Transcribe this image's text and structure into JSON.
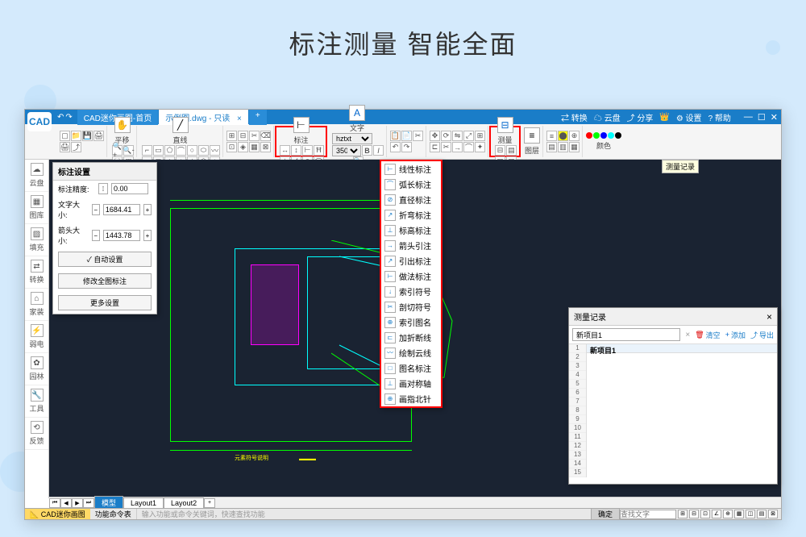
{
  "hero_title": "标注测量 智能全面",
  "titlebar": {
    "logo": "CAD",
    "tab_home": "CAD迷你画图-首页",
    "tab_file": "示例图.dwg - 只读",
    "menu_convert": "⇄ 转换",
    "menu_cloud": "☁ 云盘",
    "menu_share": "⤴ 分享",
    "menu_settings": "⚙ 设置",
    "menu_help": "? 帮助"
  },
  "ribbon": {
    "pan_label": "平移",
    "line_label": "直线",
    "annot_label": "标注",
    "text_label": "文字",
    "font_name": "hztxt",
    "font_size": "350",
    "measure_label": "测量",
    "layer_label": "图层",
    "color_label": "颜色"
  },
  "sidebar": {
    "items": [
      {
        "icon": "☁",
        "label": "云盘"
      },
      {
        "icon": "▦",
        "label": "图库"
      },
      {
        "icon": "▨",
        "label": "填充"
      },
      {
        "icon": "⇄",
        "label": "转换"
      },
      {
        "icon": "⌂",
        "label": "家装"
      },
      {
        "icon": "⚡",
        "label": "弱电"
      },
      {
        "icon": "✿",
        "label": "园林"
      },
      {
        "icon": "🔧",
        "label": "工具"
      },
      {
        "icon": "⟲",
        "label": "反馈"
      }
    ]
  },
  "annot_panel": {
    "title": "标注设置",
    "precision_label": "标注精度:",
    "precision_value": "0.00",
    "text_size_label": "文字大小:",
    "text_size_value": "1684.41",
    "arrow_size_label": "箭头大小:",
    "arrow_size_value": "1443.78",
    "auto_btn": "✓ 自动设置",
    "modify_btn": "修改全图标注",
    "more_btn": "更多设置"
  },
  "annot_dropdown": {
    "items": [
      {
        "icon": "⊢",
        "label": "线性标注"
      },
      {
        "icon": "⌒",
        "label": "弧长标注"
      },
      {
        "icon": "⊘",
        "label": "直径标注"
      },
      {
        "icon": "↗",
        "label": "折弯标注"
      },
      {
        "icon": "⊥",
        "label": "标高标注"
      },
      {
        "icon": "→",
        "label": "箭头引注"
      },
      {
        "icon": "↗",
        "label": "引出标注"
      },
      {
        "icon": "⊢",
        "label": "做法标注"
      },
      {
        "icon": "↓",
        "label": "索引符号"
      },
      {
        "icon": "✂",
        "label": "剖切符号"
      },
      {
        "icon": "⊕",
        "label": "索引图名"
      },
      {
        "icon": "⊏",
        "label": "加折断线"
      },
      {
        "icon": "〰",
        "label": "绘制云线"
      },
      {
        "icon": "□",
        "label": "图名标注"
      },
      {
        "icon": "⊥",
        "label": "画对称轴"
      },
      {
        "icon": "⊕",
        "label": "画指北针"
      }
    ]
  },
  "measure_tooltip": "测量记录",
  "measure_panel": {
    "title": "测量记录",
    "project_name": "新项目1",
    "clear": "清空",
    "add": "添加",
    "export": "导出",
    "header": "新项目1",
    "rows": [
      "1",
      "2",
      "3",
      "4",
      "5",
      "6",
      "7",
      "8",
      "9",
      "10",
      "11",
      "12",
      "13",
      "14",
      "15"
    ]
  },
  "bottom_tabs": {
    "model": "模型",
    "layout1": "Layout1",
    "layout2": "Layout2"
  },
  "statusbar": {
    "app": "CAD迷你画图",
    "cmd_table": "功能命令表",
    "input_hint": "输入功能或命令关键词，快速查找功能",
    "confirm": "确定",
    "search_placeholder": "查找文字"
  }
}
